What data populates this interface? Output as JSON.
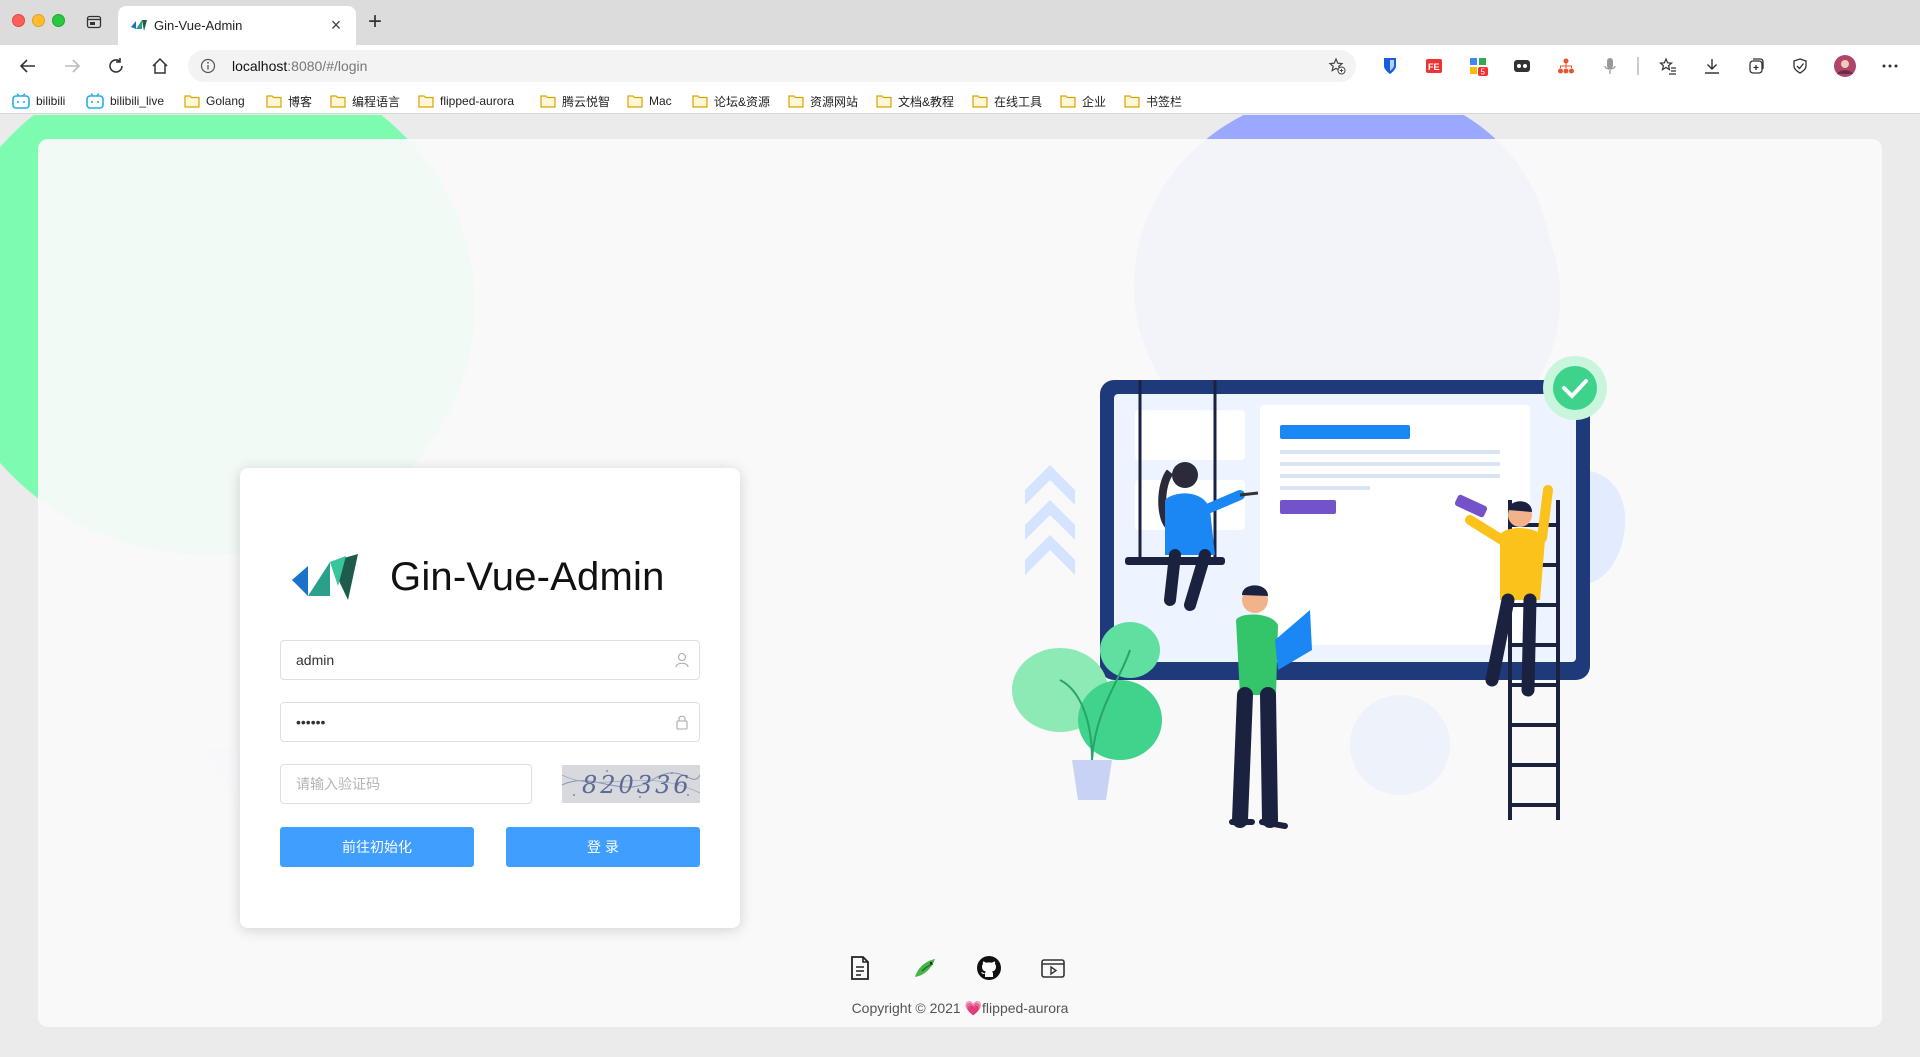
{
  "browser": {
    "tab_title": "Gin-Vue-Admin",
    "address": {
      "host": "localhost",
      "path": ":8080/#/login"
    },
    "bookmarks": [
      {
        "label": "bilibili",
        "icon": "bilibili-icon"
      },
      {
        "label": "bilibili_live",
        "icon": "bilibili-icon"
      },
      {
        "label": "Golang",
        "icon": "folder-icon"
      },
      {
        "label": "博客",
        "icon": "folder-icon"
      },
      {
        "label": "编程语言",
        "icon": "folder-icon"
      },
      {
        "label": "flipped-aurora",
        "icon": "folder-icon"
      },
      {
        "label": "腾云悦智",
        "icon": "folder-icon"
      },
      {
        "label": "Mac",
        "icon": "folder-icon"
      },
      {
        "label": "论坛&资源",
        "icon": "folder-icon"
      },
      {
        "label": "资源网站",
        "icon": "folder-icon"
      },
      {
        "label": "文档&教程",
        "icon": "folder-icon"
      },
      {
        "label": "在线工具",
        "icon": "folder-icon"
      },
      {
        "label": "企业",
        "icon": "folder-icon"
      },
      {
        "label": "书签栏",
        "icon": "folder-icon"
      }
    ],
    "extension_badge": "5"
  },
  "login": {
    "title": "Gin-Vue-Admin",
    "username_value": "admin",
    "password_value": "••••••",
    "captcha_placeholder": "请输入验证码",
    "captcha_text": "820336",
    "init_button_label": "前往初始化",
    "login_button_label": "登 录"
  },
  "footer": {
    "icons": [
      "document-icon",
      "bird-icon",
      "github-icon",
      "video-icon"
    ],
    "copyright_prefix": "Copyright © 2021 ",
    "copyright_heart": "💗",
    "copyright_author": "flipped-aurora"
  },
  "colors": {
    "primary": "#409eff",
    "blob_green": "#7dfcb1",
    "blob_blue": "#9aa8ff",
    "illustration_navy": "#1f3a7a",
    "illustration_check": "#3ed38b"
  }
}
